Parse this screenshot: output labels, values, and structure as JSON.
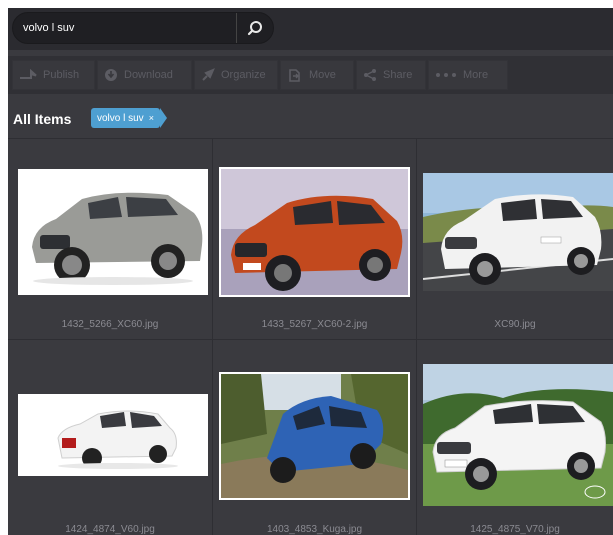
{
  "search": {
    "value": "volvo l suv",
    "button_icon": "search-icon"
  },
  "toolbar": {
    "items": [
      {
        "label": "Publish",
        "icon": "publish-arrow-icon"
      },
      {
        "label": "Download",
        "icon": "download-icon"
      },
      {
        "label": "Organize",
        "icon": "organize-icon"
      },
      {
        "label": "Move",
        "icon": "move-icon"
      },
      {
        "label": "Share",
        "icon": "share-icon"
      },
      {
        "label": "More",
        "icon": "more-icon"
      }
    ]
  },
  "filter": {
    "title": "All Items",
    "tag_label": "volvo l suv",
    "tag_remove": "×"
  },
  "grid": {
    "items": [
      {
        "filename": "1432_5266_XC60.jpg",
        "selected": false,
        "car_color": "#9a9b97",
        "scene": "studio"
      },
      {
        "filename": "1433_5267_XC60-2.jpg",
        "selected": true,
        "car_color": "#c2491e",
        "scene": "studio"
      },
      {
        "filename": "XC90.jpg",
        "selected": false,
        "car_color": "#f2f2f2",
        "scene": "road"
      },
      {
        "filename": "1424_4874_V60.jpg",
        "selected": false,
        "car_color": "#f3f3f3",
        "scene": "studio"
      },
      {
        "filename": "1403_4853_Kuga.jpg",
        "selected": true,
        "car_color": "#2e63b5",
        "scene": "offroad"
      },
      {
        "filename": "1425_4875_V70.jpg",
        "selected": false,
        "car_color": "#f4f4f4",
        "scene": "park"
      }
    ]
  },
  "colors": {
    "background": "#3a3a3f",
    "toolbar": "#303035",
    "tag": "#4e9fd1",
    "filename_text": "#8b8b92"
  }
}
